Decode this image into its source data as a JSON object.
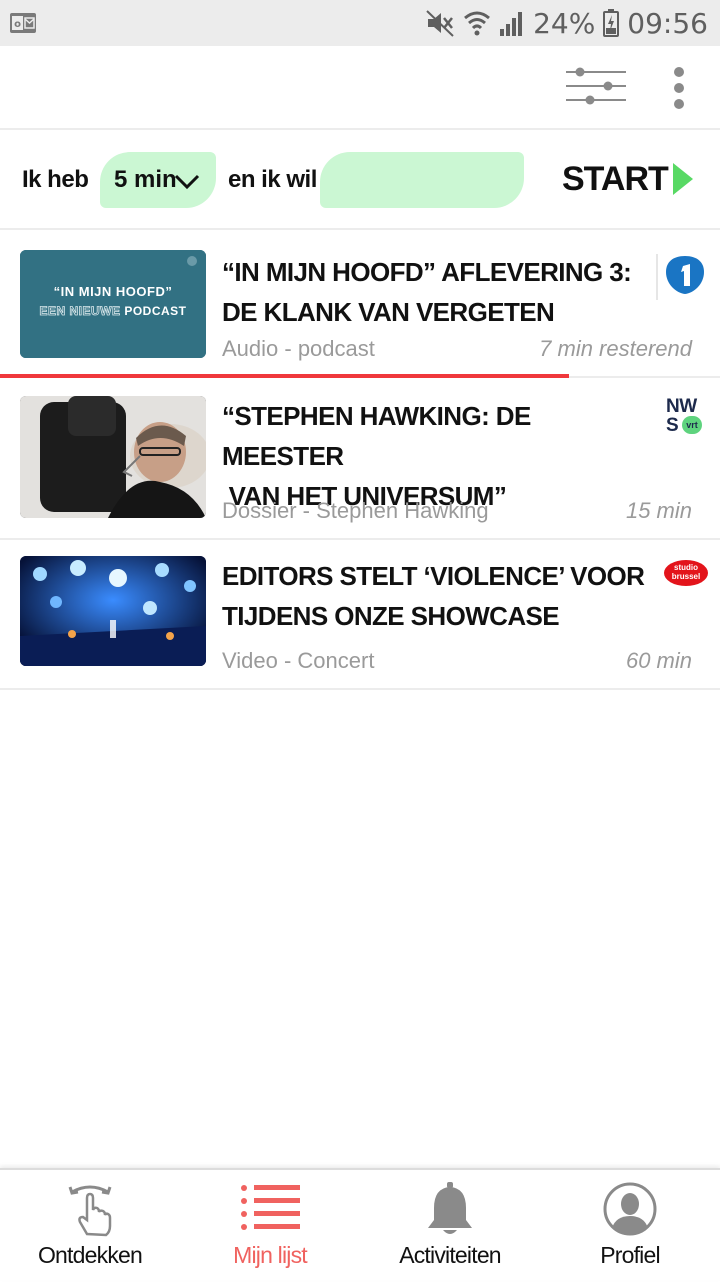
{
  "status_bar": {
    "battery": "24%",
    "time": "09:56",
    "icons": [
      "outlook-icon",
      "mute-icon",
      "wifi-icon",
      "signal-icon",
      "battery-charging-icon"
    ]
  },
  "toolbar": {
    "icons": [
      "filter-sliders-icon",
      "more-vert-icon"
    ]
  },
  "time_bar": {
    "prefix": "Ik heb",
    "duration": "5 min",
    "middle": "en ik wil",
    "want_value": "",
    "start_label": "START",
    "pill_color": "#cbf7d3",
    "arrow_color": "#58d964"
  },
  "items": [
    {
      "title": "“IN MIJN HOOFD” AFLEVERING 3: DE KLANK VAN VERGETEN",
      "thumb_line1": "“IN MIJN HOOFD”",
      "thumb_line2_a": "EEN NIEUWE",
      "thumb_line2_b": "PODCAST",
      "meta": "Audio - podcast",
      "duration": "7 min resterend",
      "brand": "radio1-logo",
      "progress": 0.79
    },
    {
      "title_line1": "“STEPHEN HAWKING: DE MEESTER",
      "title_line2": " VAN HET UNIVERSUM”",
      "meta": "Dossier - Stephen Hawking",
      "duration": "15 min",
      "brand_line1": "NW",
      "brand_line2": "S",
      "brand_badge": "vrt"
    },
    {
      "title": "EDITORS STELT ‘VIOLENCE’ VOOR TIJDENS ONZE SHOWCASE",
      "meta": "Video - Concert",
      "duration": "60 min",
      "brand_line1": "studio",
      "brand_line2": "brussel"
    }
  ],
  "nav": {
    "items": [
      {
        "label": "Ontdekken",
        "icon": "swipe-hand-icon",
        "active": false
      },
      {
        "label": "Mijn lijst",
        "icon": "list-icon",
        "active": true
      },
      {
        "label": "Activiteiten",
        "icon": "bell-icon",
        "active": false
      },
      {
        "label": "Profiel",
        "icon": "profile-icon",
        "active": false
      }
    ],
    "active_color": "#f0625f"
  },
  "colors": {
    "accent_red": "#f0383c",
    "pill_green": "#cbf7d3",
    "start_arrow": "#58d964"
  }
}
